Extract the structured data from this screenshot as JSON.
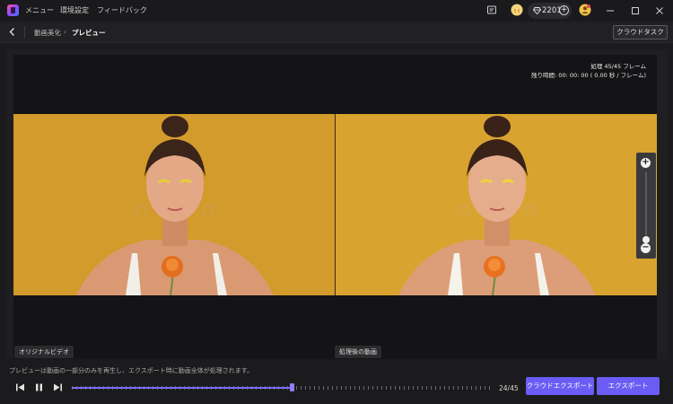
{
  "titlebar": {
    "menu": [
      "メニュー",
      "環境設定",
      "フィードバック"
    ],
    "coins": "2201"
  },
  "toolbar": {
    "back_label": "",
    "breadcrumb": [
      "動画美化",
      "プレビュー"
    ],
    "cloud_task_label": "クラウドタスク"
  },
  "preview": {
    "processing_line": "処理 45/45 フレーム",
    "remaining_line": "残り時間: 00: 00: 00 ( 0.00 秒 / フレーム)",
    "original_label": "オリジナルビデオ",
    "processed_label": "処理後の動画"
  },
  "playback": {
    "hint": "プレビューは動画の一部分のみを再生し、エクスポート時に動画全体が処理されます。",
    "current_frame": 24,
    "total_frames": 45,
    "frame_display": "24/45",
    "progress_fraction": 0.524
  },
  "actions": {
    "cloud_export_label": "クラウドエクスポート",
    "export_label": "エクスポート"
  },
  "colors": {
    "accent": "#6a5cf5",
    "background": "#1b1b1d",
    "photo_background": "#d6a02e"
  },
  "icons": {
    "app": "app-logo-icon",
    "back": "chevron-left-icon",
    "gem": "diamond-icon",
    "play_prev": "step-back-icon",
    "pause": "pause-icon",
    "play_next": "step-forward-icon"
  }
}
